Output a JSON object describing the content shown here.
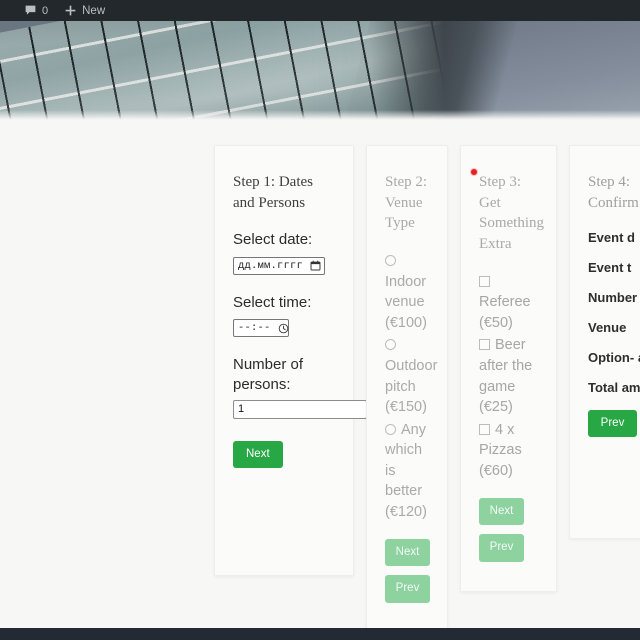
{
  "adminbar": {
    "comment_icon": "comment-bubble-icon",
    "comment_count": "0",
    "plus_icon": "plus-icon",
    "new_label": "New"
  },
  "hero": {
    "alt": "glass-office-building-facade-photo"
  },
  "steps": [
    {
      "id": "step1",
      "title": "Step 1: Dates and Persons",
      "date_label": "Select date:",
      "date_placeholder": "дд.мм.гггг",
      "date_icon": "calendar-icon",
      "time_label": "Select time:",
      "time_placeholder": "--:--",
      "time_icon": "clock-icon",
      "persons_label": "Number of persons:",
      "persons_value": "1",
      "next_label": "Next"
    },
    {
      "id": "step2",
      "title": "Step 2: Venue Type",
      "options": [
        {
          "label": "Indoor venue (€100)"
        },
        {
          "label": "Outdoor pitch (€150)"
        },
        {
          "label": "Any which is better (€120)"
        }
      ],
      "next_label": "Next",
      "prev_label": "Prev"
    },
    {
      "id": "step3",
      "title": "Step 3: Get Something Extra",
      "options": [
        {
          "label": "Referee (€50)"
        },
        {
          "label": "Beer after the game (€25)"
        },
        {
          "label": "4 x Pizzas (€60)"
        }
      ],
      "next_label": "Next",
      "prev_label": "Prev"
    },
    {
      "id": "step4",
      "title": "Step 4: Confirm",
      "summary": [
        {
          "label": "Event d"
        },
        {
          "label": "Event t"
        },
        {
          "label": "Number persons"
        },
        {
          "label": "Venue"
        },
        {
          "label": "Option- add-on"
        },
        {
          "label": "Total amount"
        }
      ],
      "prev_label": "Prev"
    }
  ],
  "colors": {
    "accent_green": "#28a745",
    "accent_green_faded": "#8ed2a0",
    "adminbar_bg": "#23282d",
    "page_bg": "#f7f7f6",
    "card_bg": "#fbfbfa",
    "pointer_dot": "#e8201e"
  }
}
